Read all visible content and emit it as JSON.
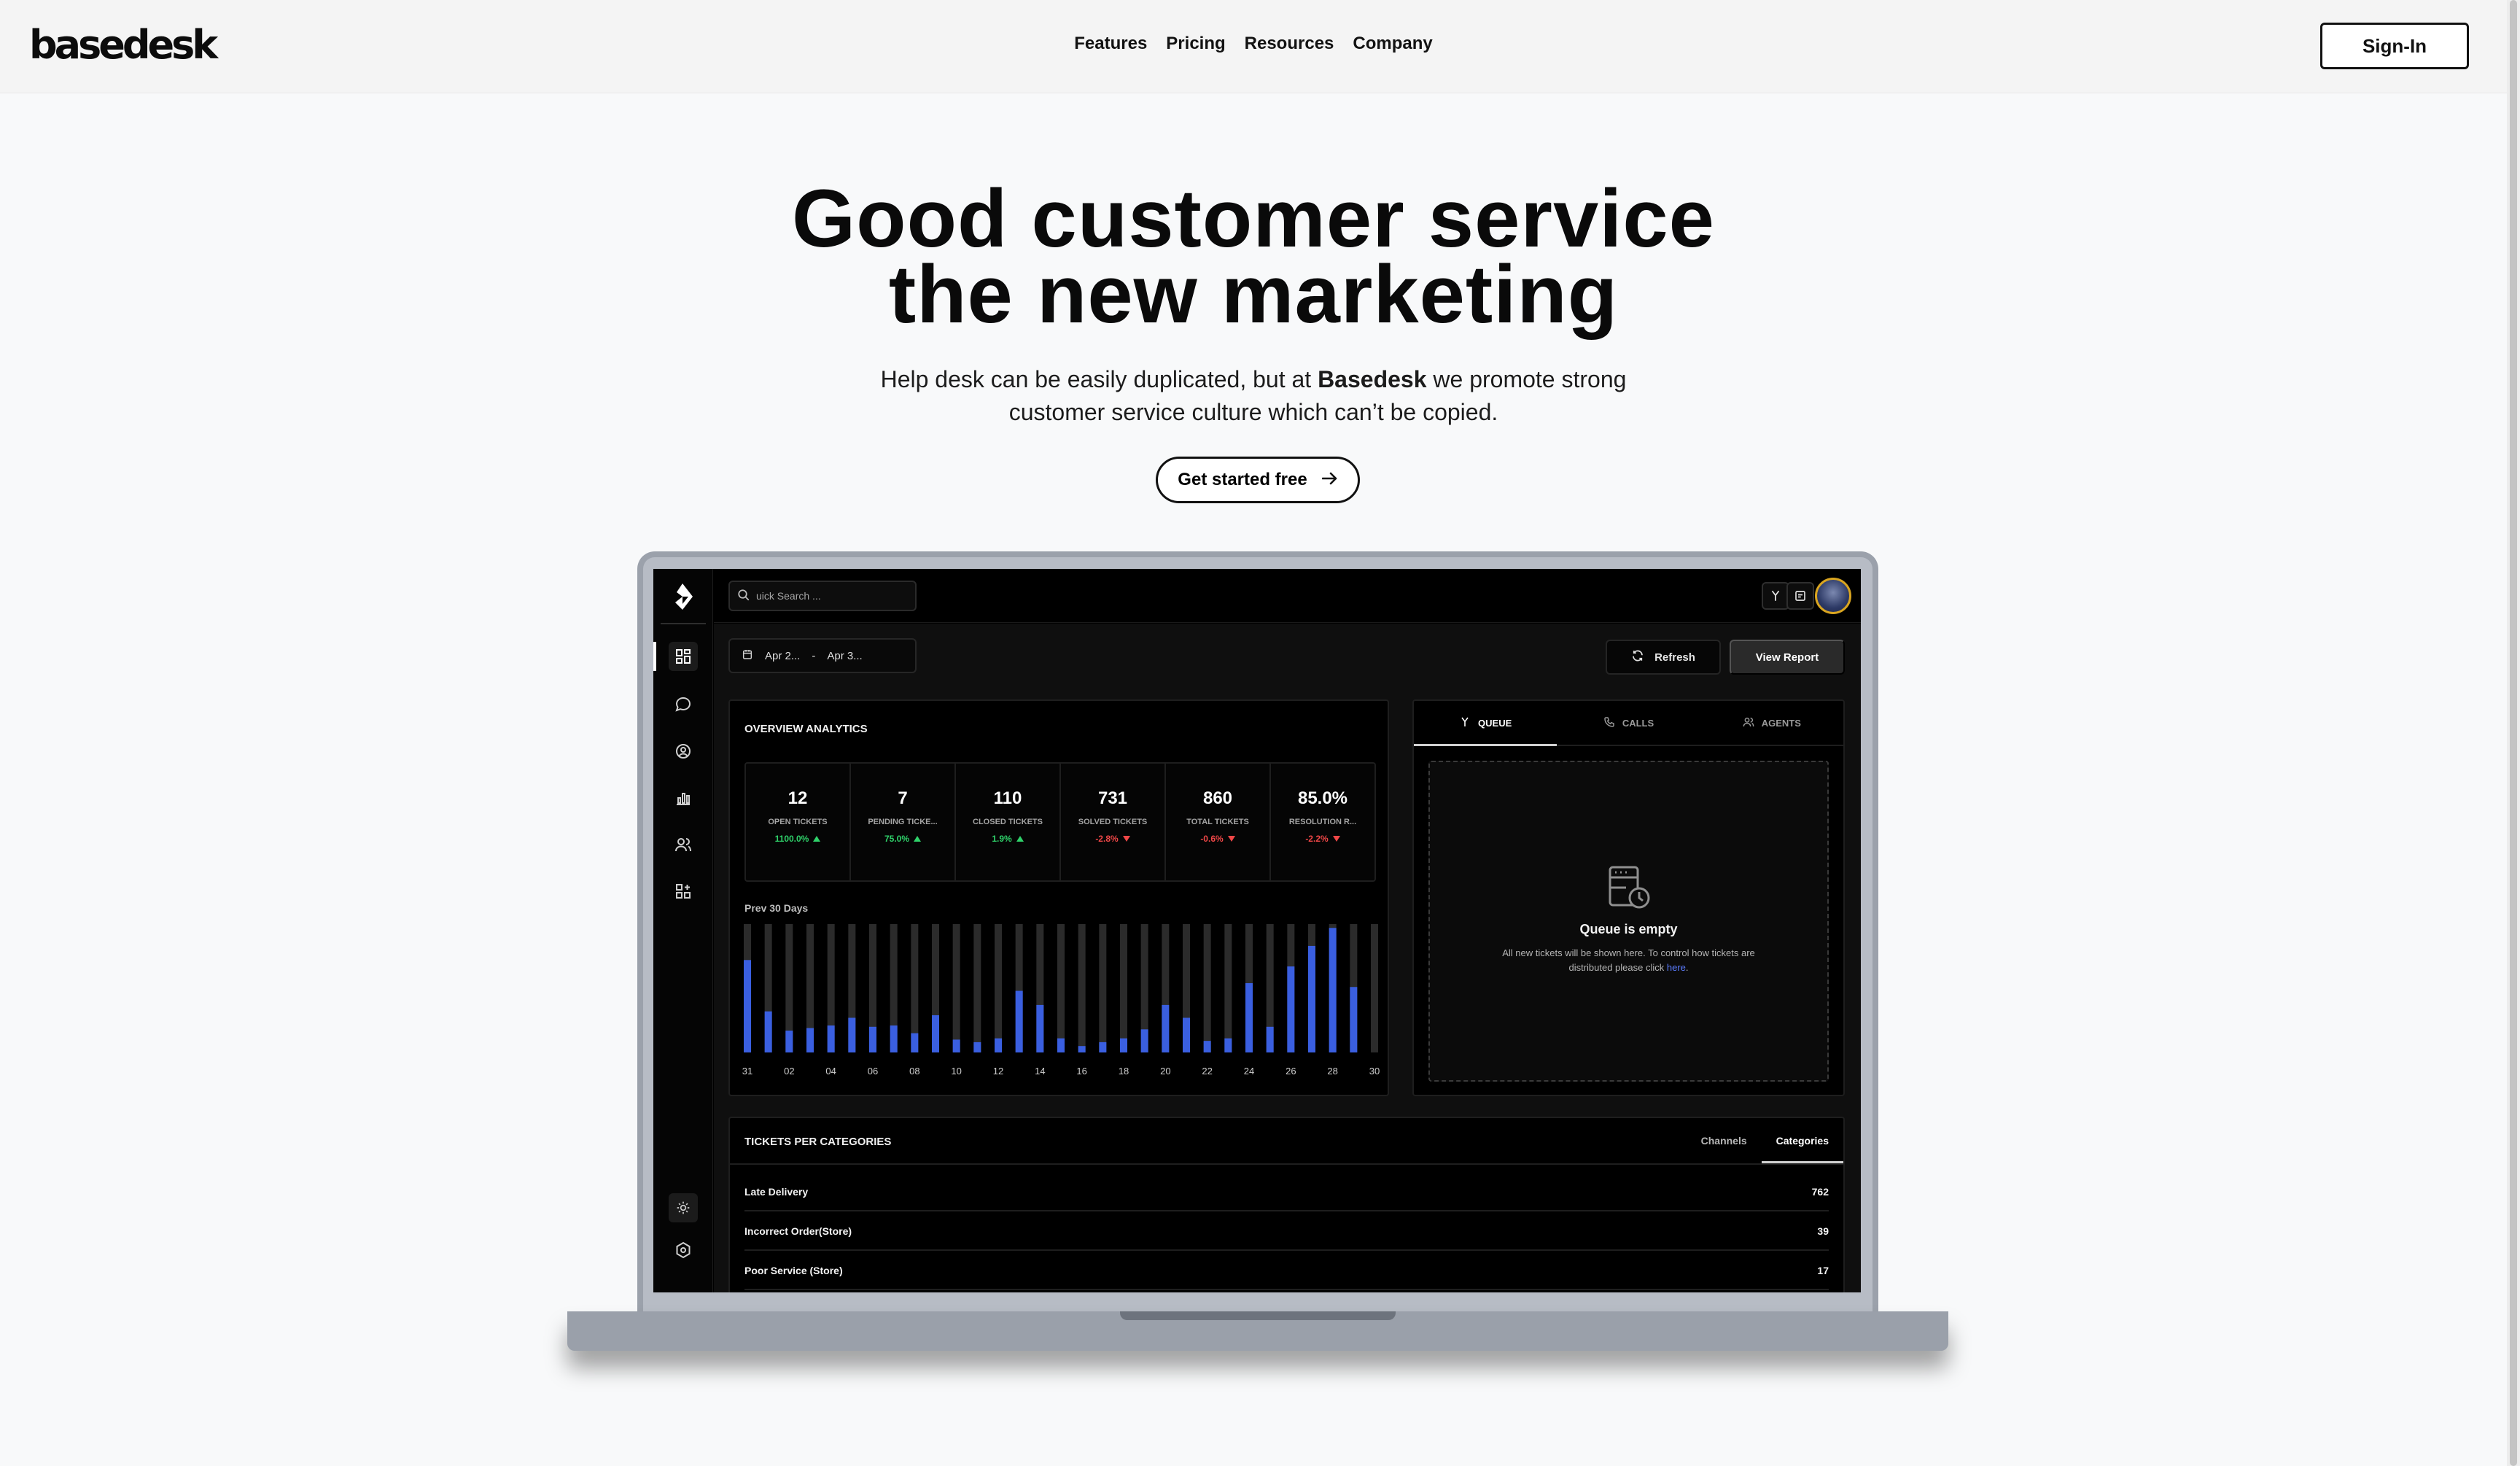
{
  "nav": {
    "logo": "basedesk",
    "links": [
      "Features",
      "Pricing",
      "Resources",
      "Company"
    ],
    "signin": "Sign-In"
  },
  "hero": {
    "title_line1": "Good customer service",
    "title_line2": "the new marketing",
    "sub_before": "Help desk can be easily duplicated, but at ",
    "sub_brand": "Basedesk",
    "sub_after": " we promote strong",
    "sub_line2": "customer service culture which can’t be copied.",
    "cta": "Get started free"
  },
  "app": {
    "search_placeholder": "uick Search ...",
    "date_from": "Apr 2...",
    "date_sep": "-",
    "date_to": "Apr 3...",
    "refresh": "Refresh",
    "view_report": "View Report",
    "overview_title": "OVERVIEW ANALYTICS",
    "stats": [
      {
        "value": "12",
        "label": "OPEN TICKETS",
        "delta": "1100.0%",
        "dir": "up"
      },
      {
        "value": "7",
        "label": "PENDING TICKE...",
        "delta": "75.0%",
        "dir": "up"
      },
      {
        "value": "110",
        "label": "CLOSED TICKETS",
        "delta": "1.9%",
        "dir": "up"
      },
      {
        "value": "731",
        "label": "SOLVED TICKETS",
        "delta": "-2.8%",
        "dir": "down"
      },
      {
        "value": "860",
        "label": "TOTAL TICKETS",
        "delta": "-0.6%",
        "dir": "down"
      },
      {
        "value": "85.0%",
        "label": "RESOLUTION R...",
        "delta": "-2.2%",
        "dir": "down"
      }
    ],
    "prev30": "Prev 30 Days",
    "queue_tabs": [
      "QUEUE",
      "CALLS",
      "AGENTS"
    ],
    "queue_empty_title": "Queue is empty",
    "queue_empty_text": "All new tickets will be shown here. To control how tickets are distributed please click ",
    "queue_empty_link": "here",
    "queue_empty_end": ".",
    "categories_title": "TICKETS PER CATEGORIES",
    "category_tabs": [
      "Channels",
      "Categories"
    ],
    "categories": [
      {
        "name": "Late Delivery",
        "count": "762"
      },
      {
        "name": "Incorrect Order(Store)",
        "count": "39"
      },
      {
        "name": "Poor Service (Store)",
        "count": "17"
      }
    ]
  },
  "colors": {
    "bar_fill": "#3a5fe0",
    "bar_track": "#2b2b2b",
    "up": "#2fd26a",
    "down": "#f04747",
    "link": "#5b7cff",
    "avatar_ring": "#d9a520"
  },
  "chart_data": {
    "type": "bar",
    "title": "Prev 30 Days",
    "categories": [
      "31",
      "01",
      "02",
      "03",
      "04",
      "05",
      "06",
      "07",
      "08",
      "09",
      "10",
      "11",
      "12",
      "13",
      "14",
      "15",
      "16",
      "17",
      "18",
      "19",
      "20",
      "21",
      "22",
      "23",
      "24",
      "25",
      "26",
      "27",
      "28",
      "29",
      "30"
    ],
    "tick_labels": [
      "31",
      "02",
      "04",
      "06",
      "08",
      "10",
      "12",
      "14",
      "16",
      "18",
      "20",
      "22",
      "24",
      "26",
      "28",
      "30"
    ],
    "values": [
      72,
      32,
      17,
      19,
      21,
      27,
      20,
      21,
      15,
      29,
      10,
      8,
      11,
      48,
      37,
      11,
      5,
      8,
      11,
      18,
      37,
      27,
      9,
      11,
      54,
      20,
      67,
      83,
      97,
      51,
      0
    ],
    "ylim": [
      0,
      100
    ],
    "grid": false,
    "legend": "none"
  }
}
